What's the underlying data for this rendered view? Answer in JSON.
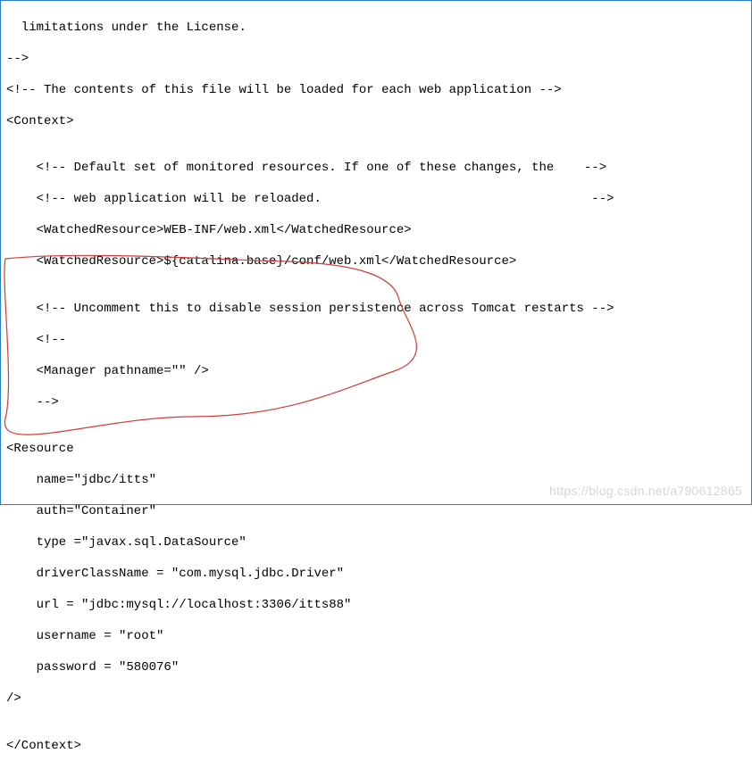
{
  "lines": {
    "l1": "  limitations under the License.",
    "l2": "-->",
    "l3": "<!-- The contents of this file will be loaded for each web application -->",
    "l4": "<Context>",
    "l5": "",
    "l6": "<!-- Default set of monitored resources. If one of these changes, the    -->",
    "l7": "<!-- web application will be reloaded.                                    -->",
    "l8": "<WatchedResource>WEB-INF/web.xml</WatchedResource>",
    "l9": "<WatchedResource>${catalina.base}/conf/web.xml</WatchedResource>",
    "l10": "",
    "l11": "<!-- Uncomment this to disable session persistence across Tomcat restarts -->",
    "l12": "<!--",
    "l13": "<Manager pathname=\"\" />",
    "l14": "-->",
    "l15": "",
    "l16": "<Resource",
    "l17": "name=\"jdbc/itts\"",
    "l18": "auth=\"Container\"",
    "l19": "type =\"javax.sql.DataSource\"",
    "l20": "driverClassName = \"com.mysql.jdbc.Driver\"",
    "l21": "url = \"jdbc:mysql://localhost:3306/itts88\"",
    "l22": "username = \"root\"",
    "l23": "password = \"580076\"",
    "l24": "/>",
    "l25": "",
    "l26": "</Context>"
  },
  "watermark": "https://blog.csdn.net/a790612865",
  "annotation_color": "#d13b3b"
}
